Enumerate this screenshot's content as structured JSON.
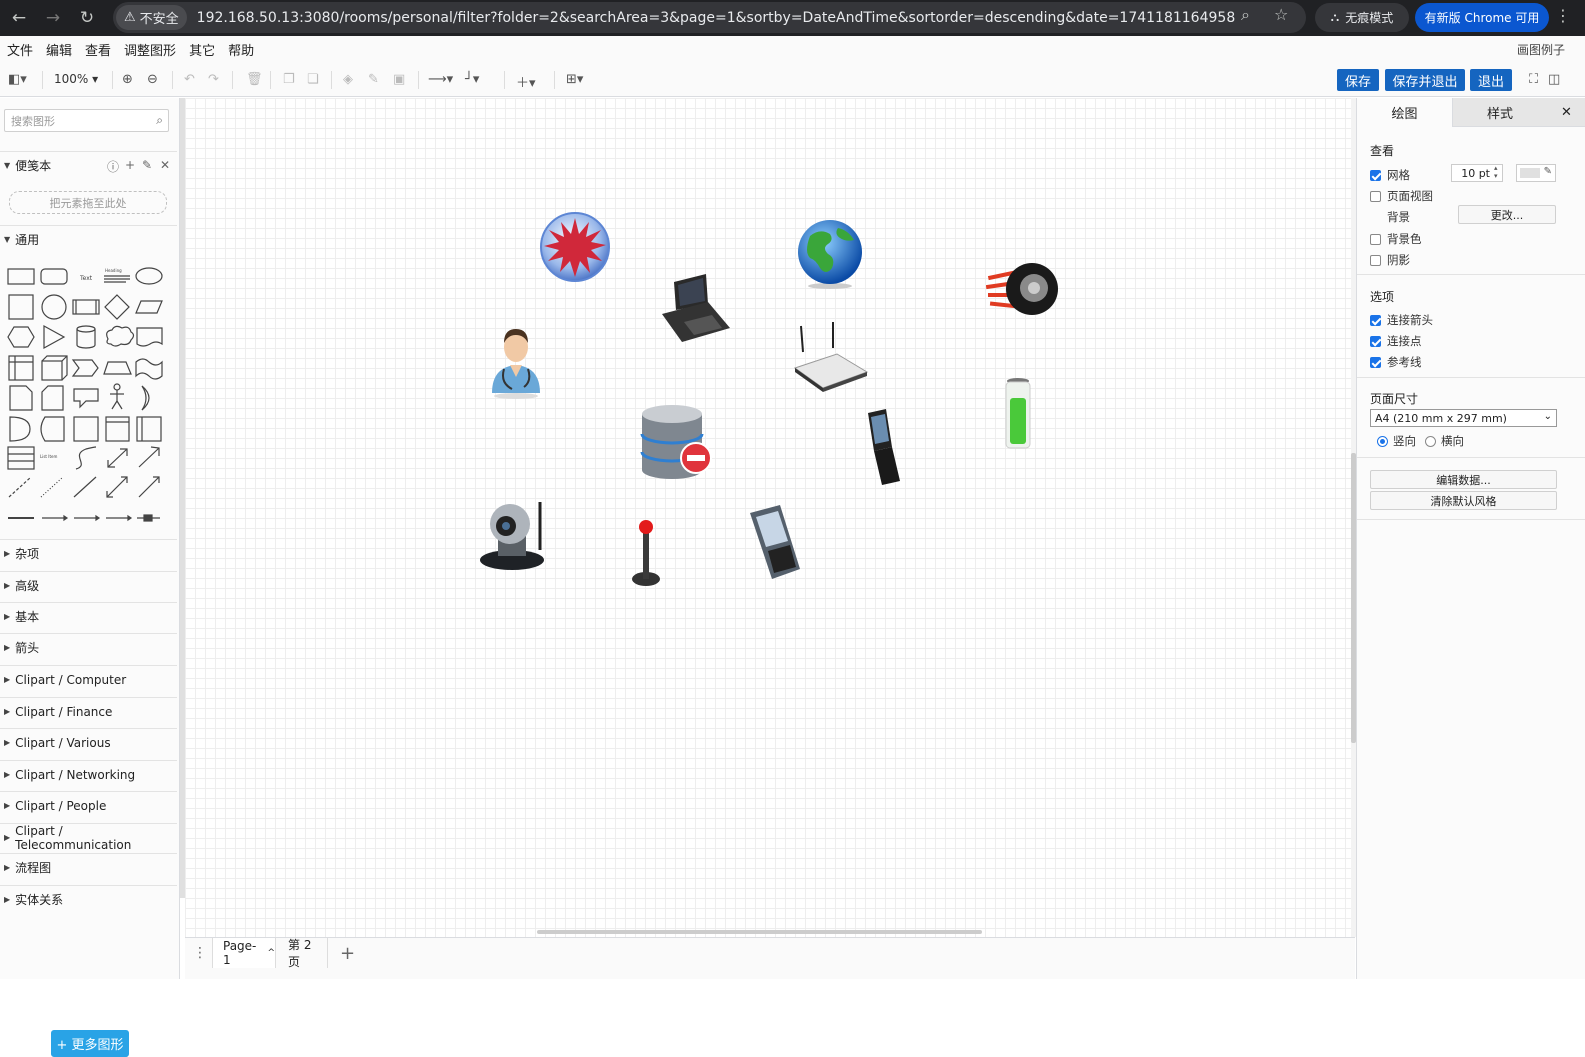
{
  "browser": {
    "security_label": "不安全",
    "url": "192.168.50.13:3080/rooms/personal/filter?folder=2&searchArea=3&page=1&sortby=DateAndTime&sortorder=descending&date=1741181164958",
    "incognito_label": "无痕模式",
    "update_label": "有新版 Chrome 可用"
  },
  "menubar": {
    "items": [
      "文件",
      "编辑",
      "查看",
      "调整图形",
      "其它",
      "帮助"
    ],
    "right_label": "画图例子"
  },
  "toolbar": {
    "zoom": "100%",
    "save": "保存",
    "save_exit": "保存并退出",
    "exit": "退出"
  },
  "sidebar": {
    "search_placeholder": "搜索图形",
    "scratchpad_title": "便笺本",
    "drop_hint": "把元素拖至此处",
    "general_title": "通用",
    "text_shape_label": "Text",
    "heading_shape_label": "Heading",
    "list_shape_label": "List Item",
    "sections": [
      "杂项",
      "高级",
      "基本",
      "箭头",
      "Clipart / Computer",
      "Clipart / Finance",
      "Clipart / Various",
      "Clipart / Networking",
      "Clipart / People",
      "Clipart / Telecommunication",
      "流程图",
      "实体关系"
    ],
    "more_shapes": "+ 更多图形"
  },
  "pages": {
    "tabs": [
      "Page-1",
      "第 2 页"
    ]
  },
  "format_panel": {
    "tabs": [
      "绘图",
      "样式"
    ],
    "view_title": "查看",
    "grid_label": "网格",
    "grid_size": "10 pt",
    "page_view_label": "页面视图",
    "background_label": "背景",
    "change_button": "更改...",
    "bg_color_label": "背景色",
    "shadow_label": "阴影",
    "options_title": "选项",
    "connection_arrows_label": "连接箭头",
    "connection_points_label": "连接点",
    "guides_label": "参考线",
    "page_size_title": "页面尺寸",
    "page_size_value": "A4 (210 mm x 297 mm)",
    "portrait_label": "竖向",
    "landscape_label": "横向",
    "edit_data_button": "编辑数据...",
    "clear_style_button": "清除默认风格"
  },
  "colors": {
    "accent": "#1565c0",
    "more_shapes_bg": "#29a3e6"
  }
}
